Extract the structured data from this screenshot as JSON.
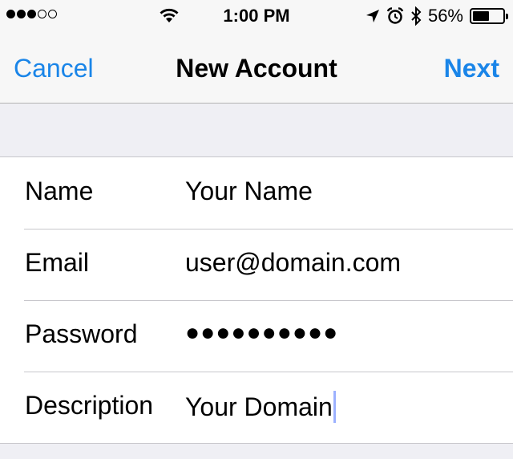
{
  "status_bar": {
    "time": "1:00 PM",
    "battery_percent": "56%",
    "battery_level": 0.56,
    "signal_bars_filled": 3,
    "signal_bars_total": 5
  },
  "nav": {
    "cancel_label": "Cancel",
    "title": "New Account",
    "next_label": "Next"
  },
  "form": {
    "name": {
      "label": "Name",
      "value": "Your Name"
    },
    "email": {
      "label": "Email",
      "value": "user@domain.com"
    },
    "password": {
      "label": "Password",
      "value": "●●●●●●●●●●"
    },
    "description": {
      "label": "Description",
      "value": "Your Domain"
    }
  },
  "colors": {
    "accent": "#1a85e8",
    "background": "#efeff4",
    "bar": "#f7f7f7",
    "cursor": "#9cb1ff"
  }
}
